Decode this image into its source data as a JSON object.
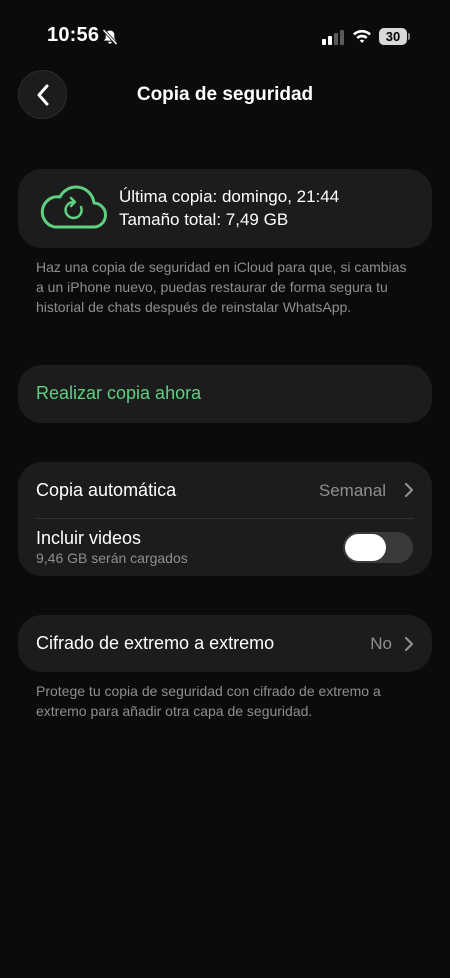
{
  "status_bar": {
    "time": "10:56",
    "battery": "30",
    "icons": [
      "bell-slash-icon",
      "cellular-signal-icon",
      "wifi-icon",
      "battery-icon"
    ]
  },
  "header": {
    "title": "Copia de seguridad",
    "back_icon": "chevron-left-icon"
  },
  "backup_info": {
    "icon": "cloud-sync-icon",
    "last_backup": "Última copia: domingo, 21:44",
    "total_size": "Tamaño total: 7,49 GB",
    "description": "Haz una copia de seguridad en iCloud para que, si cambias a un iPhone nuevo, puedas restaurar de forma segura tu historial de chats después de reinstalar WhatsApp."
  },
  "backup_now": {
    "label": "Realizar copia ahora"
  },
  "settings": {
    "auto_backup": {
      "label": "Copia automática",
      "value": "Semanal"
    },
    "include_videos": {
      "label": "Incluir videos",
      "subtext": "9,46 GB serán cargados",
      "enabled": false
    }
  },
  "encryption": {
    "label": "Cifrado de extremo a extremo",
    "value": "No",
    "description": "Protege tu copia de seguridad con cifrado de extremo a extremo para añadir otra capa de seguridad."
  },
  "colors": {
    "accent_green": "#5fcf80",
    "background": "#0b0b0b",
    "card": "#1c1c1d",
    "secondary_text": "#8e8e93"
  }
}
